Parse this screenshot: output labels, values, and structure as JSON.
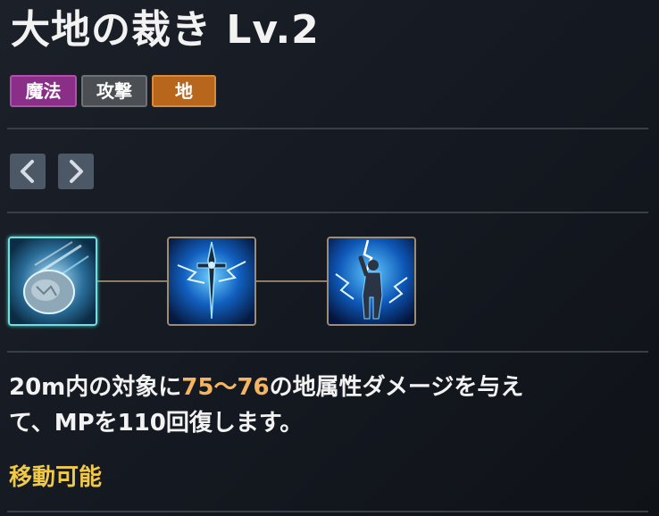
{
  "skill": {
    "title": "大地の裁き Lv.2"
  },
  "tags": [
    {
      "label": "魔法",
      "color": "#8a2f88"
    },
    {
      "label": "攻撃",
      "color": "#4b4f54"
    },
    {
      "label": "地",
      "color": "#b8661c"
    }
  ],
  "nav": {
    "prev_icon": "chevron-left-icon",
    "next_icon": "chevron-right-icon"
  },
  "skill_chain": [
    {
      "icon": "meteor-rock-icon",
      "selected": true
    },
    {
      "icon": "lightning-sword-icon",
      "selected": false
    },
    {
      "icon": "lightning-warrior-icon",
      "selected": false
    }
  ],
  "description": {
    "part1": "20m内の対象に",
    "damage": "75〜76",
    "part2": "の地属性ダメージを与え",
    "part3": "て、MPを110回復します。"
  },
  "note": "移動可能",
  "colors": {
    "highlight": "#f4b460",
    "note": "#f1c94a"
  }
}
